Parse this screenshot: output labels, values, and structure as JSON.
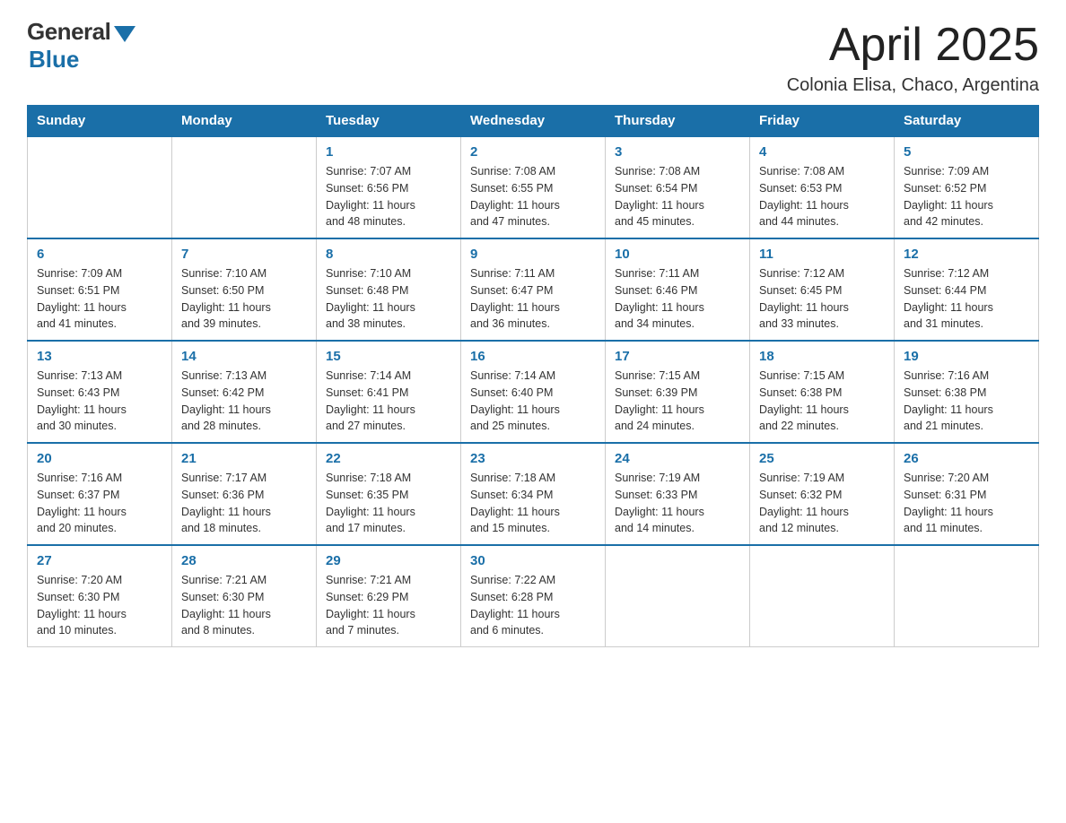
{
  "logo": {
    "general": "General",
    "blue": "Blue"
  },
  "header": {
    "month": "April 2025",
    "location": "Colonia Elisa, Chaco, Argentina"
  },
  "days_of_week": [
    "Sunday",
    "Monday",
    "Tuesday",
    "Wednesday",
    "Thursday",
    "Friday",
    "Saturday"
  ],
  "weeks": [
    [
      {
        "day": "",
        "info": ""
      },
      {
        "day": "",
        "info": ""
      },
      {
        "day": "1",
        "info": "Sunrise: 7:07 AM\nSunset: 6:56 PM\nDaylight: 11 hours\nand 48 minutes."
      },
      {
        "day": "2",
        "info": "Sunrise: 7:08 AM\nSunset: 6:55 PM\nDaylight: 11 hours\nand 47 minutes."
      },
      {
        "day": "3",
        "info": "Sunrise: 7:08 AM\nSunset: 6:54 PM\nDaylight: 11 hours\nand 45 minutes."
      },
      {
        "day": "4",
        "info": "Sunrise: 7:08 AM\nSunset: 6:53 PM\nDaylight: 11 hours\nand 44 minutes."
      },
      {
        "day": "5",
        "info": "Sunrise: 7:09 AM\nSunset: 6:52 PM\nDaylight: 11 hours\nand 42 minutes."
      }
    ],
    [
      {
        "day": "6",
        "info": "Sunrise: 7:09 AM\nSunset: 6:51 PM\nDaylight: 11 hours\nand 41 minutes."
      },
      {
        "day": "7",
        "info": "Sunrise: 7:10 AM\nSunset: 6:50 PM\nDaylight: 11 hours\nand 39 minutes."
      },
      {
        "day": "8",
        "info": "Sunrise: 7:10 AM\nSunset: 6:48 PM\nDaylight: 11 hours\nand 38 minutes."
      },
      {
        "day": "9",
        "info": "Sunrise: 7:11 AM\nSunset: 6:47 PM\nDaylight: 11 hours\nand 36 minutes."
      },
      {
        "day": "10",
        "info": "Sunrise: 7:11 AM\nSunset: 6:46 PM\nDaylight: 11 hours\nand 34 minutes."
      },
      {
        "day": "11",
        "info": "Sunrise: 7:12 AM\nSunset: 6:45 PM\nDaylight: 11 hours\nand 33 minutes."
      },
      {
        "day": "12",
        "info": "Sunrise: 7:12 AM\nSunset: 6:44 PM\nDaylight: 11 hours\nand 31 minutes."
      }
    ],
    [
      {
        "day": "13",
        "info": "Sunrise: 7:13 AM\nSunset: 6:43 PM\nDaylight: 11 hours\nand 30 minutes."
      },
      {
        "day": "14",
        "info": "Sunrise: 7:13 AM\nSunset: 6:42 PM\nDaylight: 11 hours\nand 28 minutes."
      },
      {
        "day": "15",
        "info": "Sunrise: 7:14 AM\nSunset: 6:41 PM\nDaylight: 11 hours\nand 27 minutes."
      },
      {
        "day": "16",
        "info": "Sunrise: 7:14 AM\nSunset: 6:40 PM\nDaylight: 11 hours\nand 25 minutes."
      },
      {
        "day": "17",
        "info": "Sunrise: 7:15 AM\nSunset: 6:39 PM\nDaylight: 11 hours\nand 24 minutes."
      },
      {
        "day": "18",
        "info": "Sunrise: 7:15 AM\nSunset: 6:38 PM\nDaylight: 11 hours\nand 22 minutes."
      },
      {
        "day": "19",
        "info": "Sunrise: 7:16 AM\nSunset: 6:38 PM\nDaylight: 11 hours\nand 21 minutes."
      }
    ],
    [
      {
        "day": "20",
        "info": "Sunrise: 7:16 AM\nSunset: 6:37 PM\nDaylight: 11 hours\nand 20 minutes."
      },
      {
        "day": "21",
        "info": "Sunrise: 7:17 AM\nSunset: 6:36 PM\nDaylight: 11 hours\nand 18 minutes."
      },
      {
        "day": "22",
        "info": "Sunrise: 7:18 AM\nSunset: 6:35 PM\nDaylight: 11 hours\nand 17 minutes."
      },
      {
        "day": "23",
        "info": "Sunrise: 7:18 AM\nSunset: 6:34 PM\nDaylight: 11 hours\nand 15 minutes."
      },
      {
        "day": "24",
        "info": "Sunrise: 7:19 AM\nSunset: 6:33 PM\nDaylight: 11 hours\nand 14 minutes."
      },
      {
        "day": "25",
        "info": "Sunrise: 7:19 AM\nSunset: 6:32 PM\nDaylight: 11 hours\nand 12 minutes."
      },
      {
        "day": "26",
        "info": "Sunrise: 7:20 AM\nSunset: 6:31 PM\nDaylight: 11 hours\nand 11 minutes."
      }
    ],
    [
      {
        "day": "27",
        "info": "Sunrise: 7:20 AM\nSunset: 6:30 PM\nDaylight: 11 hours\nand 10 minutes."
      },
      {
        "day": "28",
        "info": "Sunrise: 7:21 AM\nSunset: 6:30 PM\nDaylight: 11 hours\nand 8 minutes."
      },
      {
        "day": "29",
        "info": "Sunrise: 7:21 AM\nSunset: 6:29 PM\nDaylight: 11 hours\nand 7 minutes."
      },
      {
        "day": "30",
        "info": "Sunrise: 7:22 AM\nSunset: 6:28 PM\nDaylight: 11 hours\nand 6 minutes."
      },
      {
        "day": "",
        "info": ""
      },
      {
        "day": "",
        "info": ""
      },
      {
        "day": "",
        "info": ""
      }
    ]
  ]
}
